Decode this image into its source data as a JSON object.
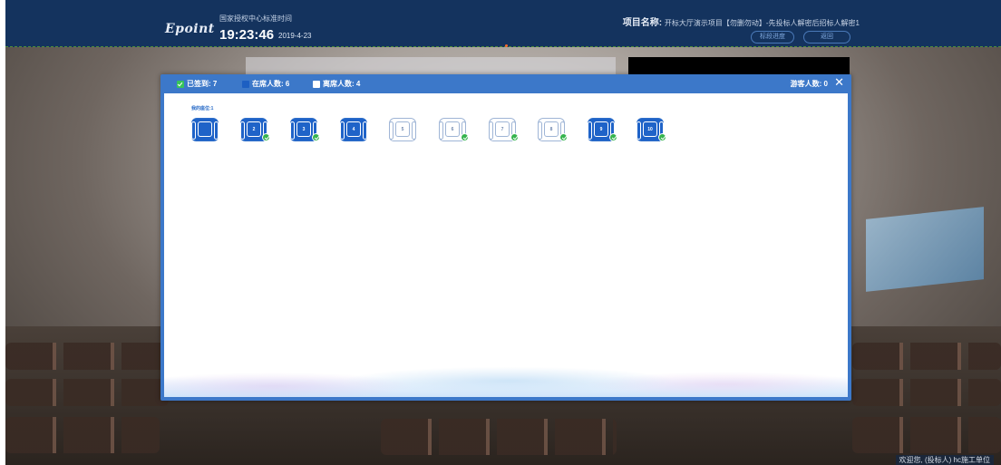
{
  "header": {
    "logo": "Epoint",
    "time_label": "国家授权中心标准时间",
    "clock": "19:23:46",
    "date": "2019-4-23",
    "project_label": "项目名称:",
    "project_name": "开标大厅演示项目【勿删勿动】-先投标人解密后招标人解密1",
    "btn_progress": "标段进度",
    "btn_back": "返回"
  },
  "modal": {
    "signed_in": "已签到: 7",
    "present": "在席人数: 6",
    "absent": "离席人数: 4",
    "visitors": "游客人数: 0",
    "close": "✕",
    "my_seat_label": "我的座位:1",
    "seats": [
      {
        "number": "",
        "state": "self",
        "checked": false
      },
      {
        "number": "2",
        "state": "present",
        "checked": true
      },
      {
        "number": "3",
        "state": "present",
        "checked": true
      },
      {
        "number": "4",
        "state": "present",
        "checked": false
      },
      {
        "number": "5",
        "state": "absent",
        "checked": false
      },
      {
        "number": "6",
        "state": "absent",
        "checked": true
      },
      {
        "number": "7",
        "state": "absent",
        "checked": true
      },
      {
        "number": "8",
        "state": "absent",
        "checked": true
      },
      {
        "number": "9",
        "state": "present",
        "checked": true
      },
      {
        "number": "10",
        "state": "present",
        "checked": true
      }
    ]
  },
  "footer": {
    "welcome": "欢迎您, (投标人) hc施工单位"
  },
  "colors": {
    "header_bg": "#14335e",
    "modal_blue": "#3c78c9",
    "seat_present": "#1f63c8",
    "check_green": "#36b44e"
  }
}
